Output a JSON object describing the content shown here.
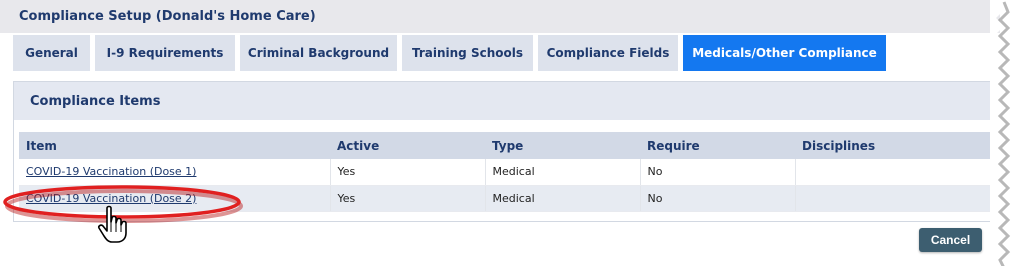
{
  "header": {
    "title": "Compliance Setup (Donald's Home Care)"
  },
  "tabs": [
    {
      "label": "General",
      "active": false
    },
    {
      "label": "I-9 Requirements",
      "active": false
    },
    {
      "label": "Criminal Background",
      "active": false
    },
    {
      "label": "Training Schools",
      "active": false
    },
    {
      "label": "Compliance Fields",
      "active": false
    },
    {
      "label": "Medicals/Other Compliance",
      "active": true
    }
  ],
  "panel": {
    "title": "Compliance Items"
  },
  "table": {
    "columns": [
      "Item",
      "Active",
      "Type",
      "Require",
      "Disciplines"
    ],
    "rows": [
      {
        "item": "COVID-19 Vaccination (Dose 1)",
        "active": "Yes",
        "type": "Medical",
        "require": "No",
        "disciplines": ""
      },
      {
        "item": "COVID-19 Vaccination (Dose 2)",
        "active": "Yes",
        "type": "Medical",
        "require": "No",
        "disciplines": ""
      }
    ]
  },
  "footer": {
    "cancel_label": "Cancel"
  },
  "colors": {
    "accent": "#1478f0",
    "title_text": "#1f3a6e",
    "cancel_bg": "#3d5e70",
    "annotation": "#e02020"
  },
  "icons": {
    "cursor": "hand-pointer-icon",
    "highlight": "red-ellipse-highlight"
  }
}
